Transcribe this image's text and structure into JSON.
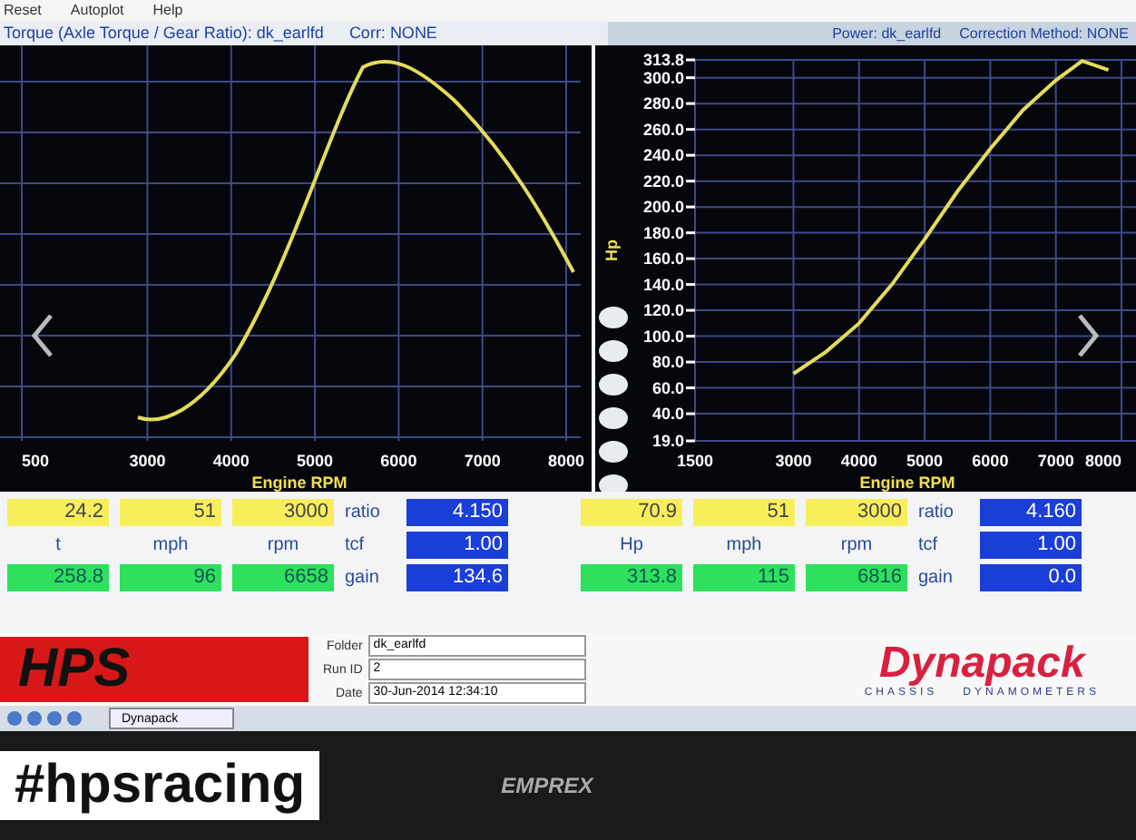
{
  "menu": [
    {
      "label": "Reset"
    },
    {
      "label": "Autoplot"
    },
    {
      "label": "Help"
    }
  ],
  "left_header": {
    "title": "Torque (Axle Torque / Gear Ratio): dk_earlfd",
    "correction": "Corr: NONE"
  },
  "right_header": {
    "power": "Power: dk_earlfd",
    "correction": "Correction Method: NONE"
  },
  "torque_chart": {
    "x_tick_labels": [
      "500",
      "3000",
      "4000",
      "5000",
      "6000",
      "7000",
      "8000"
    ],
    "xlabel": "Engine RPM"
  },
  "power_chart": {
    "chart_data": {
      "type": "line",
      "xlabel": "Engine RPM",
      "ylabel": "Hp",
      "x": [
        3000,
        3500,
        4000,
        4500,
        5000,
        5500,
        6000,
        6500,
        7000,
        7400,
        7800
      ],
      "series": [
        {
          "color": "#e4dc5a",
          "values": [
            71,
            88,
            110,
            140,
            175,
            212,
            245,
            275,
            298,
            313,
            306
          ]
        }
      ],
      "grid": true,
      "xlim": [
        1500,
        8000
      ],
      "ylim": [
        19,
        313.8
      ],
      "xticks": [
        1500,
        3000,
        4000,
        5000,
        6000,
        7000,
        8000
      ],
      "yticks": [
        {
          "value": 19,
          "label": "19.0"
        },
        {
          "value": 40,
          "label": "40.0"
        },
        {
          "value": 60,
          "label": "60.0"
        },
        {
          "value": 80,
          "label": "80.0"
        },
        {
          "value": 100,
          "label": "100.0"
        },
        {
          "value": 120,
          "label": "120.0"
        },
        {
          "value": 140,
          "label": "140.0"
        },
        {
          "value": 160,
          "label": "160.0"
        },
        {
          "value": 180,
          "label": "180.0"
        },
        {
          "value": 200,
          "label": "200.0"
        },
        {
          "value": 220,
          "label": "220.0"
        },
        {
          "value": 240,
          "label": "240.0"
        },
        {
          "value": 260,
          "label": "260.0"
        },
        {
          "value": 280,
          "label": "280.0"
        },
        {
          "value": 300,
          "label": "300.0"
        },
        {
          "value": 313.8,
          "label": "313.8"
        }
      ]
    }
  },
  "readouts": [
    {
      "groups": [
        {
          "label": "t",
          "current": "24.2",
          "peak": "258.8"
        },
        {
          "label": "mph",
          "current": "51",
          "peak": "96"
        },
        {
          "label": "rpm",
          "current": "3000",
          "peak": "6658"
        }
      ],
      "factors": [
        {
          "label": "ratio",
          "value": "4.150"
        },
        {
          "label": "tcf",
          "value": "1.00"
        },
        {
          "label": "gain",
          "value": "134.6"
        }
      ]
    },
    {
      "groups": [
        {
          "label": "Hp",
          "current": "70.9",
          "peak": "313.8"
        },
        {
          "label": "mph",
          "current": "51",
          "peak": "115"
        },
        {
          "label": "rpm",
          "current": "3000",
          "peak": "6816"
        }
      ],
      "factors": [
        {
          "label": "ratio",
          "value": "4.160"
        },
        {
          "label": "tcf",
          "value": "1.00"
        },
        {
          "label": "gain",
          "value": "0.0"
        }
      ]
    }
  ],
  "hps_logo": "HPS",
  "run_info": [
    {
      "label": "Folder",
      "value": "dk_earlfd"
    },
    {
      "label": "Run ID",
      "value": "2"
    },
    {
      "label": "Date",
      "value": "30-Jun-2014  12:34:10"
    }
  ],
  "logo": {
    "name": "Dynapack",
    "left": "CHASSIS",
    "right": "DYNAMOMETERS"
  },
  "taskbar": {
    "button": "Dynapack"
  },
  "monitor": {
    "brand": "EMPREX"
  },
  "sticker": "#hpsracing"
}
